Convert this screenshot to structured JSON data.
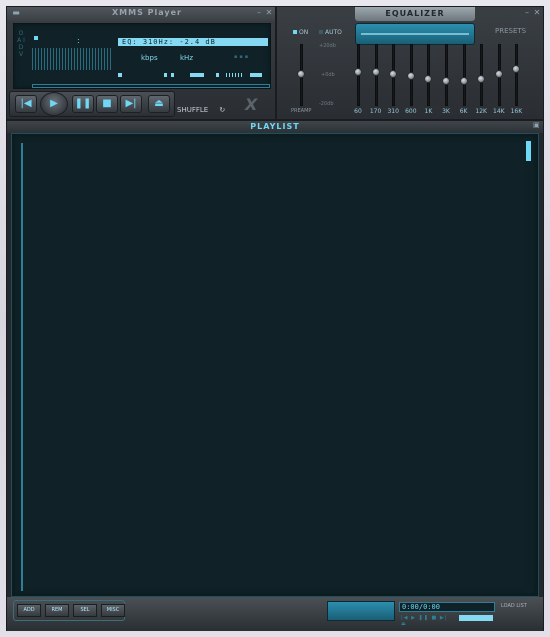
{
  "player": {
    "title": "XMMS Player",
    "menu_icon": "menu-icon",
    "minimize_icon": "minimize-icon",
    "close_icon": "close-icon",
    "clutterbar": "O A I D V",
    "time_separator": ":",
    "song_title": "EQ: 310Hz: -2.4 dB",
    "kbps_label": "kbps",
    "khz_label": "kHz",
    "shuffle_label": "SHUFFLE",
    "logo": "X",
    "transport": {
      "prev_icon": "prev-icon",
      "play_icon": "play-icon",
      "pause_icon": "pause-icon",
      "stop_icon": "stop-icon",
      "next_icon": "next-icon",
      "eject_icon": "eject-icon"
    }
  },
  "equalizer": {
    "title": "EQUALIZER",
    "on_label": "ON",
    "auto_label": "AUTO",
    "presets_label": "PRESETS",
    "db_top": "+20db",
    "db_mid": "+0db",
    "db_bottom": "-20db",
    "preamp_label": "PREAMP",
    "bands": [
      {
        "label": "60",
        "level": 0.45
      },
      {
        "label": "170",
        "level": 0.44
      },
      {
        "label": "310",
        "level": 0.48
      },
      {
        "label": "600",
        "level": 0.52
      },
      {
        "label": "1K",
        "level": 0.57
      },
      {
        "label": "3K",
        "level": 0.62
      },
      {
        "label": "6K",
        "level": 0.62
      },
      {
        "label": "12K",
        "level": 0.58
      },
      {
        "label": "14K",
        "level": 0.48
      },
      {
        "label": "16K",
        "level": 0.38
      }
    ],
    "preamp_level": 0.48,
    "colors": {
      "accent": "#6fd8f5",
      "panel": "#2a2e33"
    }
  },
  "playlist": {
    "title": "PLAYLIST",
    "buttons": [
      "ADD",
      "REM",
      "SEL",
      "MISC"
    ],
    "time": "0:00/0:00",
    "load_list": "LOAD LIST",
    "mini_controls": "|◀ ▶ ❚❚ ■ ▶| ⏏"
  }
}
